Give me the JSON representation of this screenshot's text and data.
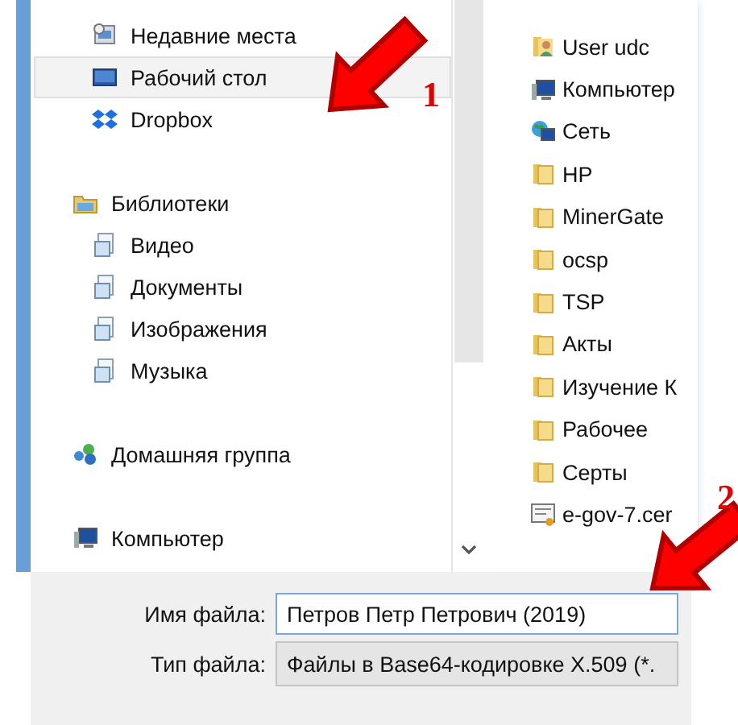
{
  "navigation": [
    {
      "children": [
        {
          "label": "Недавние места",
          "kind": "recent",
          "selected": false
        },
        {
          "label": "Рабочий стол",
          "kind": "desktop",
          "selected": true
        },
        {
          "label": "Dropbox",
          "kind": "dropbox",
          "selected": false
        }
      ]
    },
    {
      "label": "Библиотеки",
      "kind": "library",
      "selected": false,
      "children": [
        {
          "label": "Видео",
          "kind": "libitem",
          "selected": false
        },
        {
          "label": "Документы",
          "kind": "libitem",
          "selected": false
        },
        {
          "label": "Изображения",
          "kind": "libitem",
          "selected": false
        },
        {
          "label": "Музыка",
          "kind": "libitem",
          "selected": false
        }
      ]
    },
    {
      "label": "Домашняя группа",
      "kind": "homegroup",
      "selected": false
    },
    {
      "label": "Компьютер",
      "kind": "computer",
      "selected": false
    }
  ],
  "files": [
    {
      "label": "User udc",
      "kind": "user"
    },
    {
      "label": "Компьютер",
      "kind": "computer"
    },
    {
      "label": "Сеть",
      "kind": "network"
    },
    {
      "label": "HP",
      "kind": "folder"
    },
    {
      "label": "MinerGate",
      "kind": "folder"
    },
    {
      "label": "ocsp",
      "kind": "folder"
    },
    {
      "label": "TSP",
      "kind": "folder"
    },
    {
      "label": "Акты",
      "kind": "folder"
    },
    {
      "label": "Изучение К",
      "kind": "folder"
    },
    {
      "label": "Рабочее",
      "kind": "folder"
    },
    {
      "label": "Серты",
      "kind": "folder"
    },
    {
      "label": "e-gov-7.cer",
      "kind": "certificate"
    }
  ],
  "file_name": {
    "label": "Имя файла:",
    "value": "Петров Петр Петрович (2019)"
  },
  "file_type": {
    "label": "Тип файла:",
    "value": "Файлы в Base64-кодировке X.509 (*."
  },
  "annotations": [
    {
      "label": "1"
    },
    {
      "label": "2"
    }
  ]
}
